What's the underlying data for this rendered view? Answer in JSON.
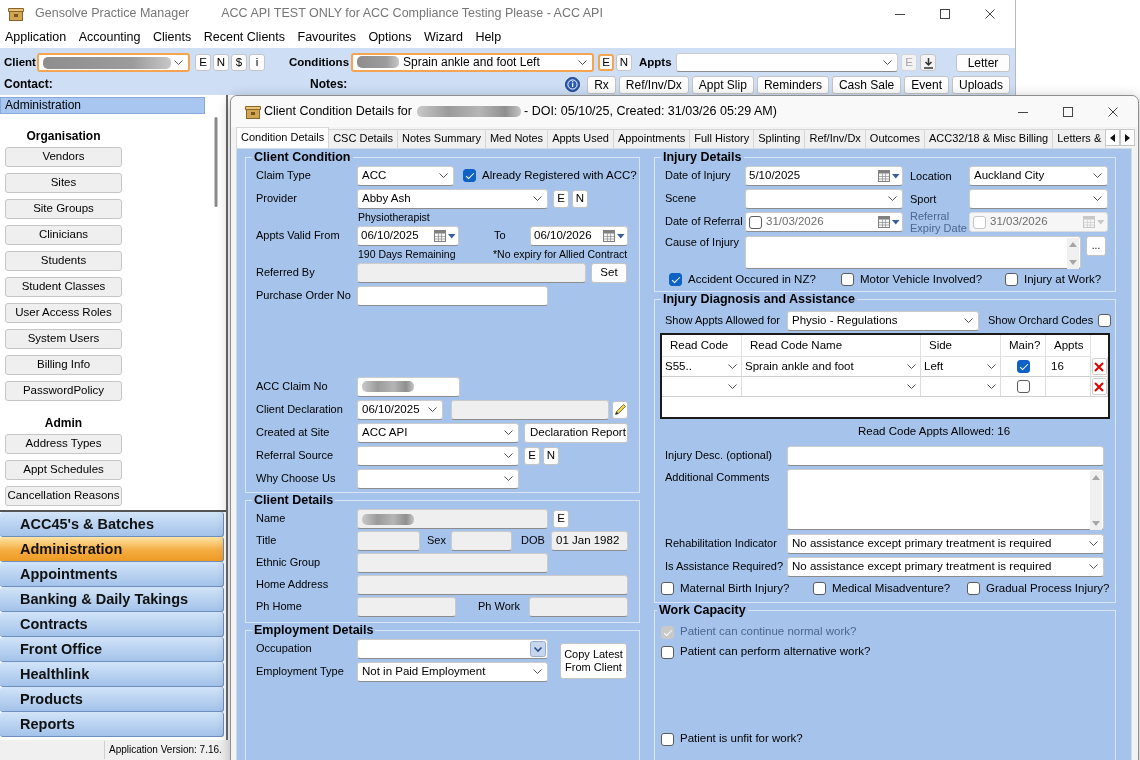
{
  "main_window": {
    "app_name": "Gensolve Practice Manager",
    "title": "ACC API TEST ONLY for ACC Compliance Testing Please - ACC API",
    "menu": [
      "Application",
      "Accounting",
      "Clients",
      "Recent Clients",
      "Favourites",
      "Options",
      "Wizard",
      "Help"
    ],
    "toolbar": {
      "client": {
        "label": "Client",
        "field": {
          "kind": "combo",
          "redacted": true,
          "highlighted": true
        },
        "buttons": [
          {
            "label": "E",
            "highlighted": false,
            "disabled": false
          },
          {
            "label": "N",
            "highlighted": false,
            "disabled": false
          },
          {
            "label": "$",
            "highlighted": false,
            "disabled": false
          },
          {
            "label": "i",
            "highlighted": false,
            "disabled": false
          }
        ]
      },
      "conditions": {
        "label": "Conditions",
        "field": {
          "kind": "combo",
          "redacted": true,
          "value": "Sprain ankle and foot Left",
          "highlighted": true
        },
        "buttons": [
          {
            "label": "E",
            "highlighted": true,
            "disabled": false
          },
          {
            "label": "N",
            "highlighted": false,
            "disabled": false
          }
        ]
      },
      "appts": {
        "label": "Appts",
        "field": {
          "kind": "combo",
          "highlighted": false
        },
        "buttons": [
          {
            "label": "E",
            "highlighted": false,
            "disabled": true
          }
        ]
      },
      "letter_button": "Letter",
      "contact_label": "Contact:",
      "notes_label": "Notes:",
      "actions": [
        "Rx",
        "Ref/Inv/Dx",
        "Appt Slip",
        "Reminders",
        "Cash Sale",
        "Event",
        "Uploads"
      ]
    }
  },
  "sidebar": {
    "header": "Administration",
    "sections": [
      {
        "title": "Organisation",
        "buttons": [
          "Vendors",
          "Sites",
          "Site Groups",
          "Clinicians",
          "Students",
          "Student Classes",
          "User Access Roles",
          "System Users",
          "Billing Info",
          "PasswordPolicy"
        ]
      },
      {
        "title": "Admin",
        "buttons": [
          "Address Types",
          "Appt Schedules",
          "Cancellation Reasons"
        ]
      }
    ],
    "nav": [
      {
        "label": "ACC45's & Batches",
        "selected": false
      },
      {
        "label": "Administration",
        "selected": true
      },
      {
        "label": "Appointments",
        "selected": false
      },
      {
        "label": "Banking & Daily Takings",
        "selected": false
      },
      {
        "label": "Contracts",
        "selected": false
      },
      {
        "label": "Front Office",
        "selected": false
      },
      {
        "label": "Healthlink",
        "selected": false
      },
      {
        "label": "Products",
        "selected": false
      },
      {
        "label": "Reports",
        "selected": false
      }
    ]
  },
  "status_bar": {
    "text": "Application Version: 7.16."
  },
  "dialog": {
    "title_parts": [
      {
        "kind": "text",
        "text": "Client Condition Details for"
      },
      {
        "kind": "redacted"
      },
      {
        "kind": "text",
        "text": "- DOI: 05/10/25, Created: 31/03/26 05:29 AM)"
      }
    ],
    "tabs": [
      {
        "label": "Condition Details",
        "selected": true
      },
      {
        "label": "CSC Details",
        "selected": false
      },
      {
        "label": "Notes Summary",
        "selected": false
      },
      {
        "label": "Med Notes",
        "selected": false
      },
      {
        "label": "Appts Used",
        "selected": false
      },
      {
        "label": "Appointments",
        "selected": false
      },
      {
        "label": "Full History",
        "selected": false
      },
      {
        "label": "Splinting",
        "selected": false
      },
      {
        "label": "Ref/Inv/Dx",
        "selected": false
      },
      {
        "label": "Outcomes",
        "selected": false
      },
      {
        "label": "ACC32/18 & Misc Billing",
        "selected": false
      },
      {
        "label": "Letters &",
        "selected": false
      }
    ],
    "client_condition": {
      "title": "Client Condition",
      "claim_type": {
        "label": "Claim Type",
        "field": {
          "kind": "combo",
          "value": "ACC"
        }
      },
      "already_registered": {
        "label": "Already Registered with ACC?",
        "checked": true
      },
      "provider": {
        "label": "Provider",
        "field": {
          "kind": "combo",
          "value": "Abby Ash"
        },
        "buttons": [
          "E",
          "N"
        ],
        "note": "Physiotherapist"
      },
      "valid_from": {
        "label": "Appts Valid From",
        "field": {
          "kind": "date",
          "value": "06/10/2025"
        },
        "note": "190 Days Remaining"
      },
      "valid_to": {
        "label": "To",
        "field": {
          "kind": "date",
          "value": "06/10/2026"
        },
        "note": "*No expiry for Allied Contract"
      },
      "referred_by": {
        "label": "Referred By",
        "field": {
          "kind": "readonly"
        },
        "buttons": [
          "Set"
        ]
      },
      "purchase_order": {
        "label": "Purchase Order No",
        "field": {
          "kind": "text"
        }
      },
      "acc_claim_no": {
        "label": "ACC Claim No",
        "field": {
          "kind": "text",
          "redacted": true
        }
      },
      "client_declaration": {
        "label": "Client Declaration",
        "field": {
          "kind": "combo",
          "value": "06/10/2025"
        },
        "extra_field": {
          "kind": "readonly"
        }
      },
      "created_at_site": {
        "label": "Created at Site",
        "field": {
          "kind": "combo",
          "value": "ACC API"
        },
        "buttons": [
          "Declaration Report"
        ]
      },
      "referral_source": {
        "label": "Referral Source",
        "field": {
          "kind": "combo"
        },
        "buttons": [
          "E",
          "N"
        ]
      },
      "why_choose_us": {
        "label": "Why Choose Us",
        "field": {
          "kind": "combo"
        }
      }
    },
    "client_details": {
      "title": "Client Details",
      "name": {
        "label": "Name",
        "field": {
          "kind": "readonly",
          "redacted": true
        },
        "buttons": [
          "E"
        ]
      },
      "title_field": {
        "label": "Title",
        "field": {
          "kind": "readonly"
        }
      },
      "sex": {
        "label": "Sex",
        "field": {
          "kind": "readonly"
        }
      },
      "dob": {
        "label": "DOB",
        "field": {
          "kind": "readonly",
          "value": "01 Jan 1982"
        }
      },
      "ethnic_group": {
        "label": "Ethnic Group",
        "field": {
          "kind": "readonly"
        }
      },
      "home_address": {
        "label": "Home Address",
        "field": {
          "kind": "readonly"
        }
      },
      "ph_home": {
        "label": "Ph Home",
        "field": {
          "kind": "readonly"
        }
      },
      "ph_work": {
        "label": "Ph Work",
        "field": {
          "kind": "readonly"
        }
      }
    },
    "employment": {
      "title": "Employment Details",
      "occupation": {
        "label": "Occupation",
        "field": {
          "kind": "dropdown"
        }
      },
      "employment_type": {
        "label": "Employment Type",
        "field": {
          "kind": "combo",
          "value": "Not in Paid Employment"
        }
      },
      "copy_button": "Copy Latest From Client"
    },
    "injury_details": {
      "title": "Injury Details",
      "date_of_injury": {
        "label": "Date of Injury",
        "field": {
          "kind": "date",
          "value": "5/10/2025"
        }
      },
      "location": {
        "label": "Location",
        "field": {
          "kind": "combo",
          "value": "Auckland City"
        }
      },
      "scene": {
        "label": "Scene",
        "field": {
          "kind": "combo"
        }
      },
      "sport": {
        "label": "Sport",
        "field": {
          "kind": "combo"
        }
      },
      "date_of_referral": {
        "label": "Date of Referral",
        "field": {
          "kind": "date",
          "value": "31/03/2026",
          "checkbox": true,
          "checked": false,
          "disabled": false
        }
      },
      "referral_expiry": {
        "label": "Referral Expiry Date",
        "field": {
          "kind": "date",
          "value": "31/03/2026",
          "checkbox": true,
          "checked": false,
          "disabled": true
        }
      },
      "cause_of_injury": {
        "label": "Cause of Injury",
        "field": {
          "kind": "textarea"
        },
        "buttons": [
          "..."
        ]
      },
      "flags": [
        {
          "label": "Accident Occured in NZ?",
          "checked": true
        },
        {
          "label": "Motor Vehicle Involved?",
          "checked": false
        },
        {
          "label": "Injury at Work?",
          "checked": false
        }
      ]
    },
    "injury_diagnosis": {
      "title": "Injury Diagnosis and Assistance",
      "show_appts_for": {
        "label": "Show Appts Allowed for",
        "field": {
          "kind": "combo",
          "value": "Physio - Regulations"
        }
      },
      "show_orchard_codes": {
        "label": "Show Orchard Codes",
        "checked": false
      },
      "read_codes": {
        "columns": [
          "Read Code",
          "Read Code Name",
          "Side",
          "Main?",
          "Appts"
        ],
        "rows": [
          {
            "read_code": "S55..",
            "read_code_name": "Sprain ankle and foot",
            "side": "Left",
            "main": true,
            "appts": "16"
          },
          {
            "main": false
          }
        ]
      },
      "appts_allowed": "Read Code Appts Allowed: 16",
      "injury_desc": {
        "label": "Injury Desc. (optional)",
        "field": {
          "kind": "text"
        }
      },
      "additional_comments": {
        "label": "Additional Comments",
        "field": {
          "kind": "textarea"
        }
      },
      "rehab_indicator": {
        "label": "Rehabilitation Indicator",
        "field": {
          "kind": "combo",
          "value": "No assistance except primary treatment is required"
        }
      },
      "assistance_required": {
        "label": "Is Assistance Required?",
        "field": {
          "kind": "combo",
          "value": "No assistance except primary treatment is required"
        }
      },
      "flags": [
        {
          "label": "Maternal Birth Injury?",
          "checked": false
        },
        {
          "label": "Medical Misadventure?",
          "checked": false
        },
        {
          "label": "Gradual Process Injury?",
          "checked": false
        }
      ]
    },
    "work_capacity": {
      "title": "Work Capacity",
      "options": [
        {
          "label": "Patient can continue normal work?",
          "checked": true,
          "disabled": true
        },
        {
          "label": "Patient can perform alternative work?",
          "checked": false,
          "disabled": false
        },
        {
          "label": "Patient is unfit for work?",
          "checked": false,
          "disabled": false
        }
      ]
    }
  }
}
